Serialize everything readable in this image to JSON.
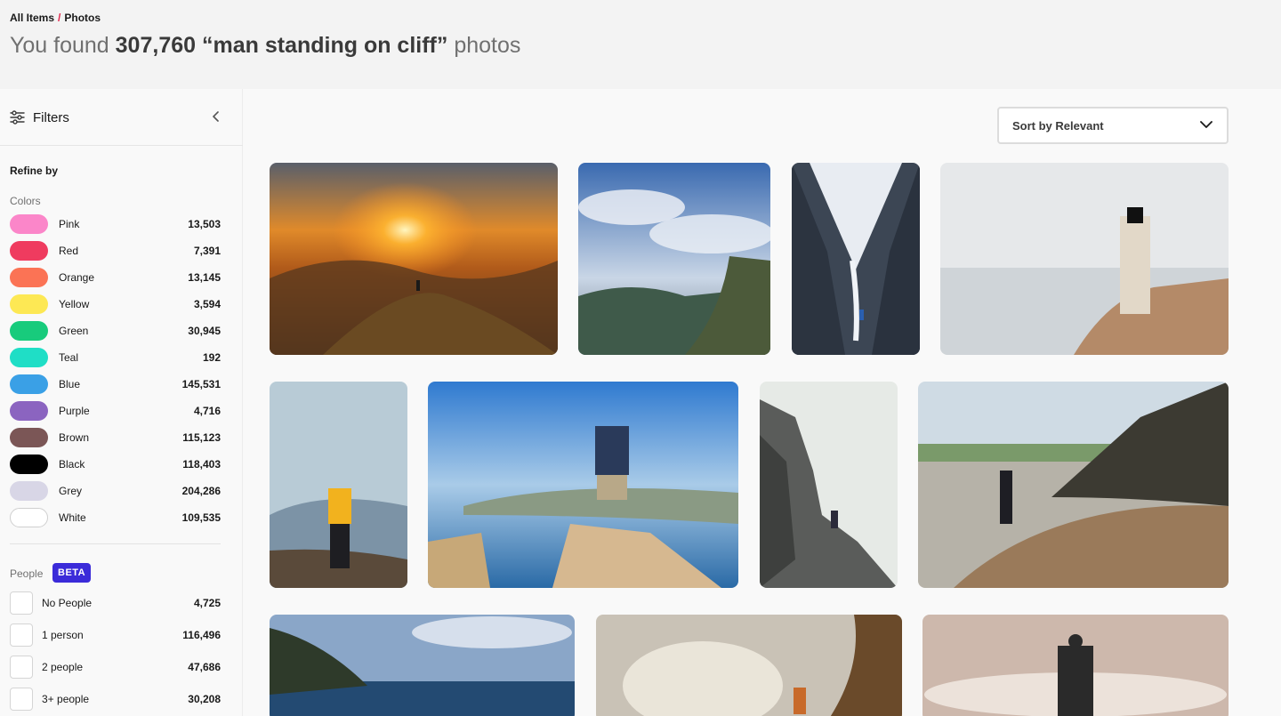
{
  "breadcrumb": {
    "root": "All Items",
    "separator": "/",
    "current": "Photos"
  },
  "headline": {
    "prefix": "You found",
    "count": "307,760",
    "query": "“man standing on cliff”",
    "suffix": "photos"
  },
  "sidebar": {
    "title": "Filters",
    "refine_label": "Refine by",
    "colors_label": "Colors",
    "colors": [
      {
        "name": "Pink",
        "count": "13,503",
        "swatch": "#fb86c9"
      },
      {
        "name": "Red",
        "count": "7,391",
        "swatch": "#ef3b5f"
      },
      {
        "name": "Orange",
        "count": "13,145",
        "swatch": "#fb7355"
      },
      {
        "name": "Yellow",
        "count": "3,594",
        "swatch": "#fde854"
      },
      {
        "name": "Green",
        "count": "30,945",
        "swatch": "#18cb7c"
      },
      {
        "name": "Teal",
        "count": "192",
        "swatch": "#1fdec6"
      },
      {
        "name": "Blue",
        "count": "145,531",
        "swatch": "#3aa0e6"
      },
      {
        "name": "Purple",
        "count": "4,716",
        "swatch": "#8b64c0"
      },
      {
        "name": "Brown",
        "count": "115,123",
        "swatch": "#7b5656"
      },
      {
        "name": "Black",
        "count": "118,403",
        "swatch": "#000000"
      },
      {
        "name": "Grey",
        "count": "204,286",
        "swatch": "#d8d6e6"
      },
      {
        "name": "White",
        "count": "109,535",
        "swatch": "#ffffff"
      }
    ],
    "people_label": "People",
    "beta_label": "BETA",
    "people": [
      {
        "name": "No People",
        "count": "4,725"
      },
      {
        "name": "1 person",
        "count": "116,496"
      },
      {
        "name": "2 people",
        "count": "47,686"
      },
      {
        "name": "3+ people",
        "count": "30,208"
      }
    ]
  },
  "sort": {
    "label": "Sort by Relevant"
  },
  "photos": [
    {
      "alt": "Hiker on mountain ridge at sunset"
    },
    {
      "alt": "Man standing on cliff top under cloudy sky"
    },
    {
      "alt": "Climber in snowy mountain valley"
    },
    {
      "alt": "Woman in hat standing on seaside rock"
    },
    {
      "alt": "Man in yellow jacket by glacier lake"
    },
    {
      "alt": "Man with raised arms on cliff above sea"
    },
    {
      "alt": "Climber on rocky cliff in fog"
    },
    {
      "alt": "Man looking down on rocky beach"
    },
    {
      "alt": "Coastline with cliffs and ocean"
    },
    {
      "alt": "Person near cliff at sunrise"
    },
    {
      "alt": "Man with backpack facing bright sea"
    }
  ],
  "colors": {
    "accent": "#e2254a",
    "beta": "#3b2bd9"
  }
}
